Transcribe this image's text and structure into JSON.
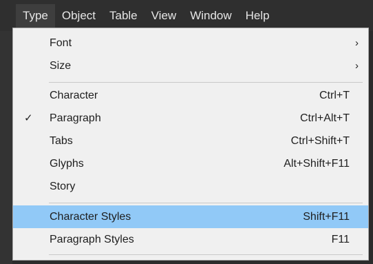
{
  "menubar": {
    "items": [
      {
        "label": "Type",
        "active": true
      },
      {
        "label": "Object"
      },
      {
        "label": "Table"
      },
      {
        "label": "View"
      },
      {
        "label": "Window"
      },
      {
        "label": "Help"
      }
    ]
  },
  "type_menu": {
    "font": {
      "label": "Font",
      "submenu_glyph": "›"
    },
    "size": {
      "label": "Size",
      "submenu_glyph": "›"
    },
    "character": {
      "label": "Character",
      "shortcut": "Ctrl+T"
    },
    "paragraph": {
      "label": "Paragraph",
      "shortcut": "Ctrl+Alt+T",
      "checked": true,
      "check_glyph": "✓"
    },
    "tabs": {
      "label": "Tabs",
      "shortcut": "Ctrl+Shift+T"
    },
    "glyphs": {
      "label": "Glyphs",
      "shortcut": "Alt+Shift+F11"
    },
    "story": {
      "label": "Story"
    },
    "character_styles": {
      "label": "Character Styles",
      "shortcut": "Shift+F11",
      "highlighted": true
    },
    "paragraph_styles": {
      "label": "Paragraph Styles",
      "shortcut": "F11"
    }
  },
  "colors": {
    "highlight": "#91c9f7",
    "menu_background": "#f0f0f0",
    "menubar_background": "#2f2f2f"
  }
}
